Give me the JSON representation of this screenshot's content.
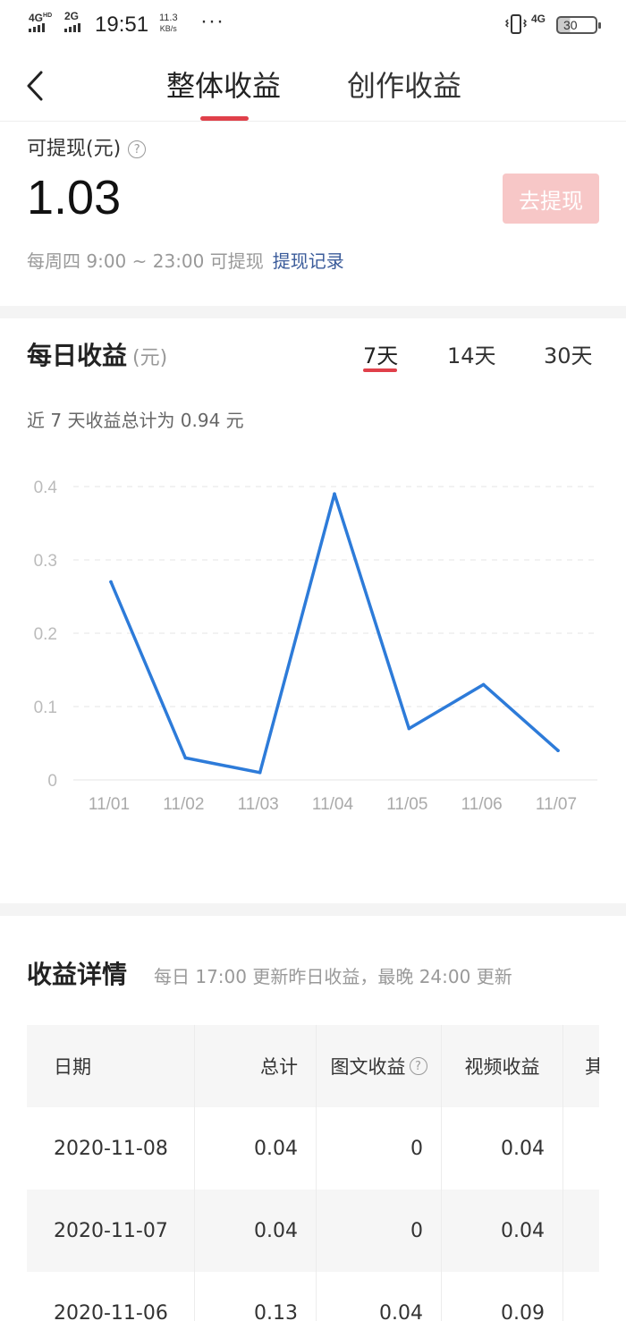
{
  "status_bar": {
    "network1": "4G",
    "network1_sup": "HD",
    "network2": "2G",
    "time": "19:51",
    "speed_value": "11.3",
    "speed_unit": "KB/s",
    "more": "···",
    "network3": "4G",
    "battery": "30",
    "icons": [
      "vibrate-icon",
      "battery-icon"
    ]
  },
  "nav": {
    "back_icon": "chevron-left-icon",
    "tabs": [
      {
        "label": "整体收益",
        "active": true
      },
      {
        "label": "创作收益",
        "active": false
      }
    ],
    "accent": "#e0404a"
  },
  "balance": {
    "label": "可提现(元)",
    "help": "?",
    "value": "1.03",
    "withdraw_button": "去提现",
    "schedule": "每周四 9:00 ~ 23:00 可提现",
    "records_link": "提现记录"
  },
  "daily": {
    "title": "每日收益",
    "unit": "(元)",
    "ranges": [
      {
        "label": "7天",
        "active": true
      },
      {
        "label": "14天",
        "active": false
      },
      {
        "label": "30天",
        "active": false
      }
    ],
    "total_note": "近 7 天收益总计为 0.94 元"
  },
  "chart_data": {
    "type": "line",
    "categories": [
      "11/01",
      "11/02",
      "11/03",
      "11/04",
      "11/05",
      "11/06",
      "11/07"
    ],
    "series": [
      {
        "values": [
          0.27,
          0.03,
          0.01,
          0.39,
          0.07,
          0.13,
          0.04
        ],
        "color": "#2d7bd9"
      }
    ],
    "yticks": [
      "0",
      "0.1",
      "0.2",
      "0.3",
      "0.4"
    ],
    "ylim": [
      0,
      0.4
    ],
    "grid": true,
    "title": "",
    "xlabel": "",
    "ylabel": ""
  },
  "details": {
    "title": "收益详情",
    "subtitle": "每日 17:00 更新昨日收益，最晚 24:00 更新",
    "headers": {
      "date": "日期",
      "total": "总计",
      "text": "图文收益",
      "video": "视频收益",
      "other": "其"
    },
    "rows": [
      {
        "date": "2020-11-08",
        "total": "0.04",
        "text": "0",
        "video": "0.04"
      },
      {
        "date": "2020-11-07",
        "total": "0.04",
        "text": "0",
        "video": "0.04"
      },
      {
        "date": "2020-11-06",
        "total": "0.13",
        "text": "0.04",
        "video": "0.09"
      }
    ]
  }
}
